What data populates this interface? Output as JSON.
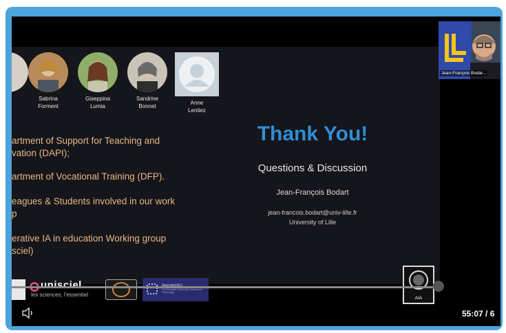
{
  "slide": {
    "people": [
      {
        "name_line1": "",
        "name_line2": ""
      },
      {
        "name_line1": "Sabrina",
        "name_line2": "Forment"
      },
      {
        "name_line1": "Giseppina",
        "name_line2": "Lumia"
      },
      {
        "name_line1": "Sandrine",
        "name_line2": "Bonnet"
      },
      {
        "name_line1": "Anne",
        "name_line2": "Lentiez"
      }
    ],
    "bullets": [
      "artment of Support for Teaching and",
      "vation (DAPI);",
      "artment of Vocational Training (DFP).",
      "eagues & Students  involved  in our work",
      "p",
      "erative IA in education Working group",
      "sciel)"
    ],
    "title": "Thank You!",
    "subtitle": "Questions & Discussion",
    "author": "Jean-François Bodart",
    "email": "jean-francois.bodart@univ-lille.fr",
    "university": "University of Lille",
    "logos": {
      "unisciel": "unisciel",
      "unisciel_tagline": "les sciences, l'essentiel",
      "neuro": "NeurotechEU",
      "neuro_tagline": "The European University of Brain and Technology"
    },
    "aia_label": "AIA"
  },
  "webcam": {
    "participant_name": "Jean-François Bodar..."
  },
  "player": {
    "time": "55:07 / 6",
    "progress_fraction": 0.99
  },
  "colors": {
    "frame_border": "#4da3dd",
    "slide_bg": "#15151c",
    "title_blue": "#2f8ed4",
    "bullet_orange": "#e6b880"
  }
}
